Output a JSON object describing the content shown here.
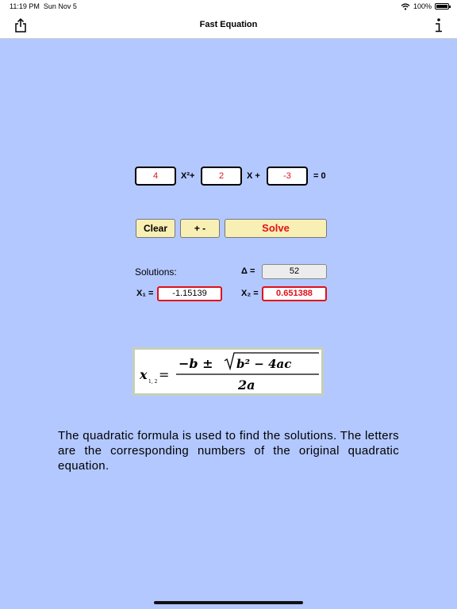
{
  "status_bar": {
    "time": "11:19 PM",
    "date": "Sun Nov 5",
    "battery": "100%",
    "battery_level": 1.0
  },
  "nav": {
    "title": "Fast Equation",
    "left_icon": "share-icon",
    "right_icon": "info-icon"
  },
  "equation": {
    "a": "4",
    "b": "2",
    "c": "-3",
    "x2_term": "X²+",
    "x_term": "X +",
    "equals_zero": "= 0"
  },
  "buttons": {
    "clear": "Clear",
    "sign": "+ -",
    "solve": "Solve"
  },
  "solutions": {
    "label": "Solutions:",
    "delta_label": "Δ =",
    "delta_value": "52",
    "x1_label": "X₁ =",
    "x1_value": "-1.15139",
    "x2_label": "X₂ =",
    "x2_value": "0.651388"
  },
  "formula": {
    "lhs": "x",
    "subscript": "1, 2",
    "equals": "=",
    "numerator_minus_b": "−b ±",
    "numerator_radicand": "b² − 4ac",
    "denominator": "2a"
  },
  "description": "The quadratic formula is used to find the solutions. The letters are the corresponding numbers of the original quadratic equation.",
  "colors": {
    "background": "#b3c8ff",
    "button_fill": "#f8efb4",
    "accent_red": "#e0101a"
  }
}
